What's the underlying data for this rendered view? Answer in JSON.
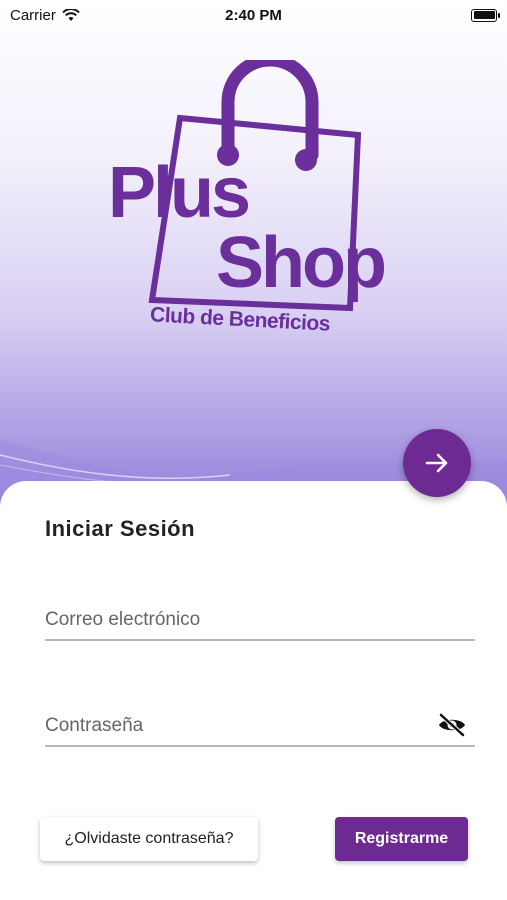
{
  "status_bar": {
    "carrier": "Carrier",
    "time": "2:40 PM",
    "wifi_icon": "wifi-icon",
    "battery_icon": "battery-icon"
  },
  "logo": {
    "word1": "Plus",
    "word2": "Shop",
    "subtitle": "Club de Beneficios",
    "icon": "shopping-bag-icon"
  },
  "fab": {
    "icon": "arrow-right-icon"
  },
  "login": {
    "title": "Iniciar Sesión",
    "email_placeholder": "Correo electrónico",
    "email_value": "",
    "password_placeholder": "Contraseña",
    "password_value": "",
    "visibility_icon": "eye-off-icon",
    "forgot_label": "¿Olvidaste contraseña?",
    "register_label": "Registrarme"
  },
  "colors": {
    "brand_purple": "#6e2a93",
    "logo_purple": "#6a2f9a"
  }
}
